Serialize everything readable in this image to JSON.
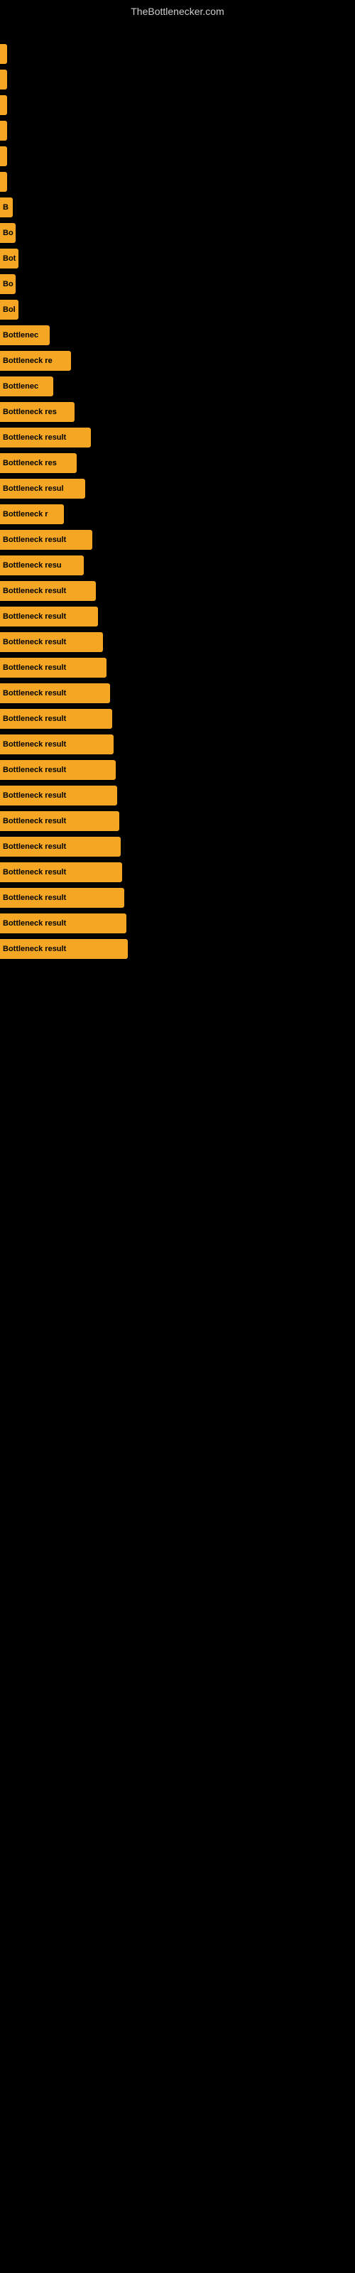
{
  "site": {
    "title": "TheBottlenecker.com"
  },
  "bars": [
    {
      "label": "",
      "width": 4
    },
    {
      "label": "",
      "width": 5
    },
    {
      "label": "",
      "width": 6
    },
    {
      "label": "",
      "width": 5
    },
    {
      "label": "",
      "width": 5
    },
    {
      "label": "",
      "width": 7
    },
    {
      "label": "B",
      "width": 18
    },
    {
      "label": "Bo",
      "width": 22
    },
    {
      "label": "Bot",
      "width": 26
    },
    {
      "label": "Bo",
      "width": 22
    },
    {
      "label": "Bol",
      "width": 26
    },
    {
      "label": "Bottlenec",
      "width": 70
    },
    {
      "label": "Bottleneck re",
      "width": 100
    },
    {
      "label": "Bottlenec",
      "width": 75
    },
    {
      "label": "Bottleneck res",
      "width": 105
    },
    {
      "label": "Bottleneck result",
      "width": 128
    },
    {
      "label": "Bottleneck res",
      "width": 108
    },
    {
      "label": "Bottleneck resul",
      "width": 120
    },
    {
      "label": "Bottleneck r",
      "width": 90
    },
    {
      "label": "Bottleneck result",
      "width": 130
    },
    {
      "label": "Bottleneck resu",
      "width": 118
    },
    {
      "label": "Bottleneck result",
      "width": 135
    },
    {
      "label": "Bottleneck result",
      "width": 138
    },
    {
      "label": "Bottleneck result",
      "width": 145
    },
    {
      "label": "Bottleneck result",
      "width": 150
    },
    {
      "label": "Bottleneck result",
      "width": 155
    },
    {
      "label": "Bottleneck result",
      "width": 158
    },
    {
      "label": "Bottleneck result",
      "width": 160
    },
    {
      "label": "Bottleneck result",
      "width": 163
    },
    {
      "label": "Bottleneck result",
      "width": 165
    },
    {
      "label": "Bottleneck result",
      "width": 168
    },
    {
      "label": "Bottleneck result",
      "width": 170
    },
    {
      "label": "Bottleneck result",
      "width": 172
    },
    {
      "label": "Bottleneck result",
      "width": 175
    },
    {
      "label": "Bottleneck result",
      "width": 178
    },
    {
      "label": "Bottleneck result",
      "width": 180
    }
  ]
}
